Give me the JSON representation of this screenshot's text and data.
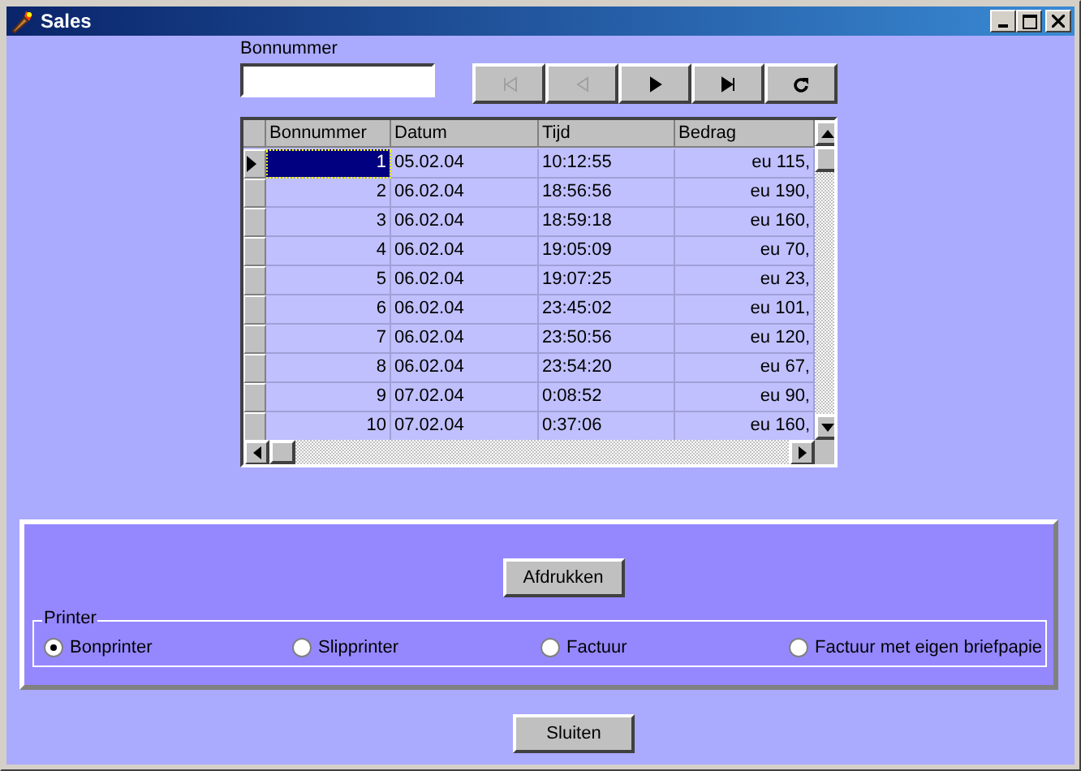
{
  "window": {
    "title": "Sales"
  },
  "bonnummer_field": {
    "label": "Bonnummer"
  },
  "navigator": [
    {
      "kind": "first",
      "disabled": true
    },
    {
      "kind": "prior",
      "disabled": true
    },
    {
      "kind": "next",
      "disabled": false
    },
    {
      "kind": "last",
      "disabled": false
    },
    {
      "kind": "refresh",
      "disabled": false
    }
  ],
  "grid": {
    "columns": [
      "Bonnummer",
      "Datum",
      "Tijd",
      "Bedrag"
    ],
    "rows": [
      {
        "cells": [
          "1",
          "05.02.04",
          "10:12:55",
          "eu 115,"
        ],
        "selected": true
      },
      {
        "cells": [
          "2",
          "06.02.04",
          "18:56:56",
          "eu 190,"
        ],
        "selected": false
      },
      {
        "cells": [
          "3",
          "06.02.04",
          "18:59:18",
          "eu 160,"
        ],
        "selected": false
      },
      {
        "cells": [
          "4",
          "06.02.04",
          "19:05:09",
          "eu 70,"
        ],
        "selected": false
      },
      {
        "cells": [
          "5",
          "06.02.04",
          "19:07:25",
          "eu 23,"
        ],
        "selected": false
      },
      {
        "cells": [
          "6",
          "06.02.04",
          "23:45:02",
          "eu 101,"
        ],
        "selected": false
      },
      {
        "cells": [
          "7",
          "06.02.04",
          "23:50:56",
          "eu 120,"
        ],
        "selected": false
      },
      {
        "cells": [
          "8",
          "06.02.04",
          "23:54:20",
          "eu 67,"
        ],
        "selected": false
      },
      {
        "cells": [
          "9",
          "07.02.04",
          "0:08:52",
          "eu 90,"
        ],
        "selected": false
      },
      {
        "cells": [
          "10",
          "07.02.04",
          "0:37:06",
          "eu 160,"
        ],
        "selected": false
      }
    ]
  },
  "print_button": "Afdrukken",
  "printer_group": {
    "label": "Printer",
    "options": [
      {
        "label": "Bonprinter",
        "selected": true
      },
      {
        "label": "Slipprinter",
        "selected": false
      },
      {
        "label": "Factuur",
        "selected": false
      },
      {
        "label": "Factuur met eigen briefpapie",
        "selected": false
      }
    ]
  },
  "close_button": "Sluiten"
}
